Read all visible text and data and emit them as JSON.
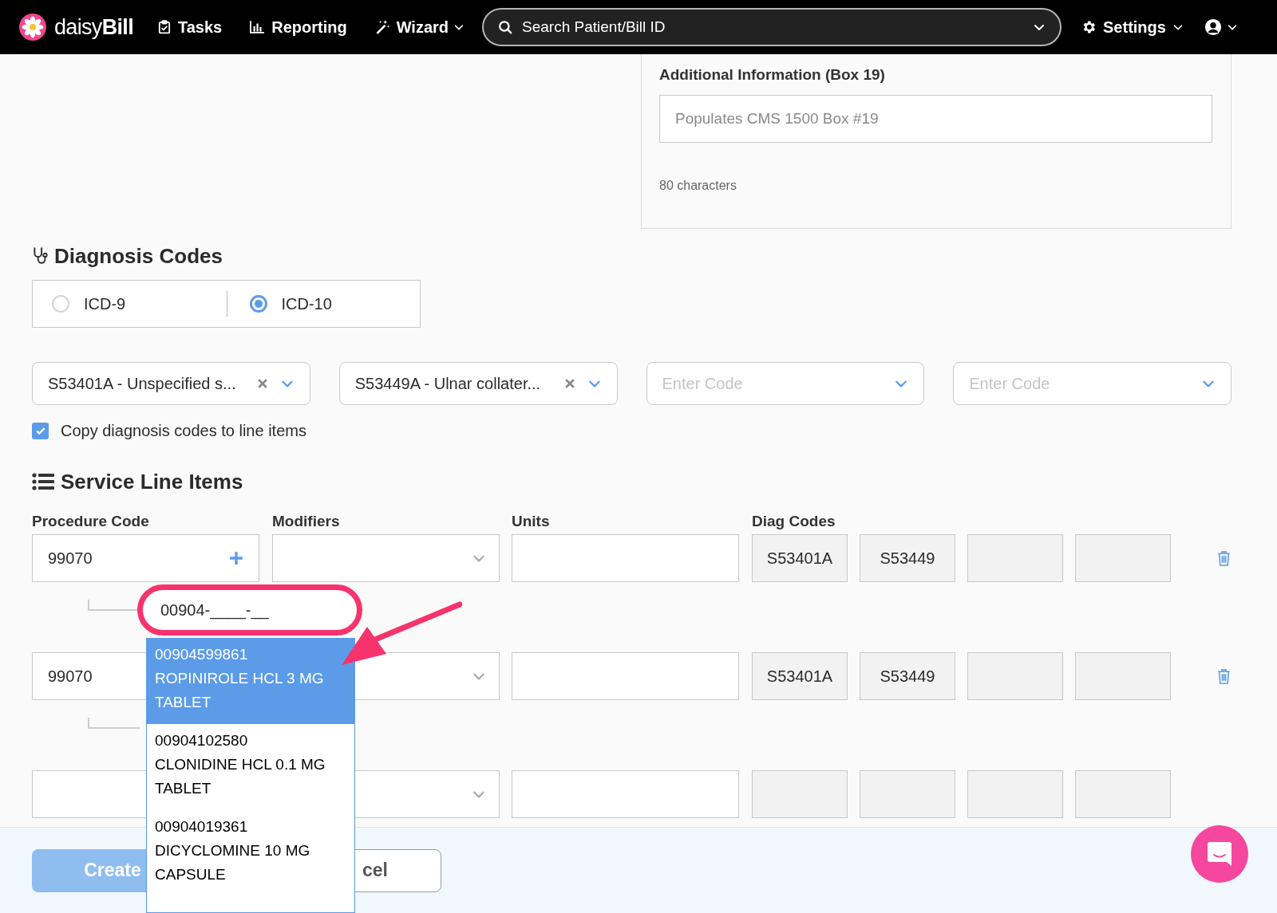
{
  "nav": {
    "logo": "daisy**Bill**",
    "items": [
      {
        "label": "Tasks",
        "kind": "tasks",
        "dropdown": false
      },
      {
        "label": "Reporting",
        "kind": "reporting",
        "dropdown": false
      },
      {
        "label": "Wizard",
        "kind": "wizard",
        "dropdown": true
      }
    ],
    "search": {
      "placeholder": "Search Patient/Bill ID"
    },
    "settings": {
      "label": "Settings"
    }
  },
  "additional_info": {
    "label": "Additional Information (Box 19)",
    "placeholder": "Populates CMS 1500 Box #19",
    "hint": "80 characters"
  },
  "diagnosis": {
    "title": "Diagnosis Codes",
    "code_sets": [
      {
        "label": "ICD-9",
        "selected": false
      },
      {
        "label": "ICD-10",
        "selected": true
      }
    ],
    "codes": [
      {
        "value": "S53401A - Unspecified s..."
      },
      {
        "value": "S53449A - Ulnar collater..."
      },
      {
        "placeholder": "Enter Code"
      },
      {
        "placeholder": "Enter Code"
      }
    ],
    "copy": {
      "label": "Copy diagnosis codes to line items",
      "checked": true
    }
  },
  "service_lines": {
    "title": "Service Line Items",
    "columns": [
      "Procedure Code",
      "Modifiers",
      "Units",
      "Diag Codes"
    ],
    "rows": [
      {
        "procedure": "99070",
        "add": true,
        "deletable": true,
        "diag_codes": [
          "S53401A",
          "S53449"
        ],
        "ndc": {
          "value": "00904-____-__"
        }
      },
      {
        "procedure": "99070",
        "deletable": true,
        "diag_codes": [
          "S53401A",
          "S53449"
        ]
      },
      {
        "deletable": false,
        "diag_codes": []
      }
    ]
  },
  "ndc_options": [
    {
      "code": "00904599861",
      "name": "ROPINIROLE HCL 3 MG TABLET",
      "selected": true
    },
    {
      "code": "00904102580",
      "name": "CLONIDINE HCL 0.1 MG TABLET",
      "selected": false
    },
    {
      "code": "00904019361",
      "name": "DICYCLOMINE 10 MG CAPSULE",
      "selected": false
    }
  ],
  "footer": {
    "buttons": [
      {
        "label": "Create",
        "kind": "primary"
      },
      {
        "label": "cel",
        "kind": "secondary"
      }
    ]
  }
}
